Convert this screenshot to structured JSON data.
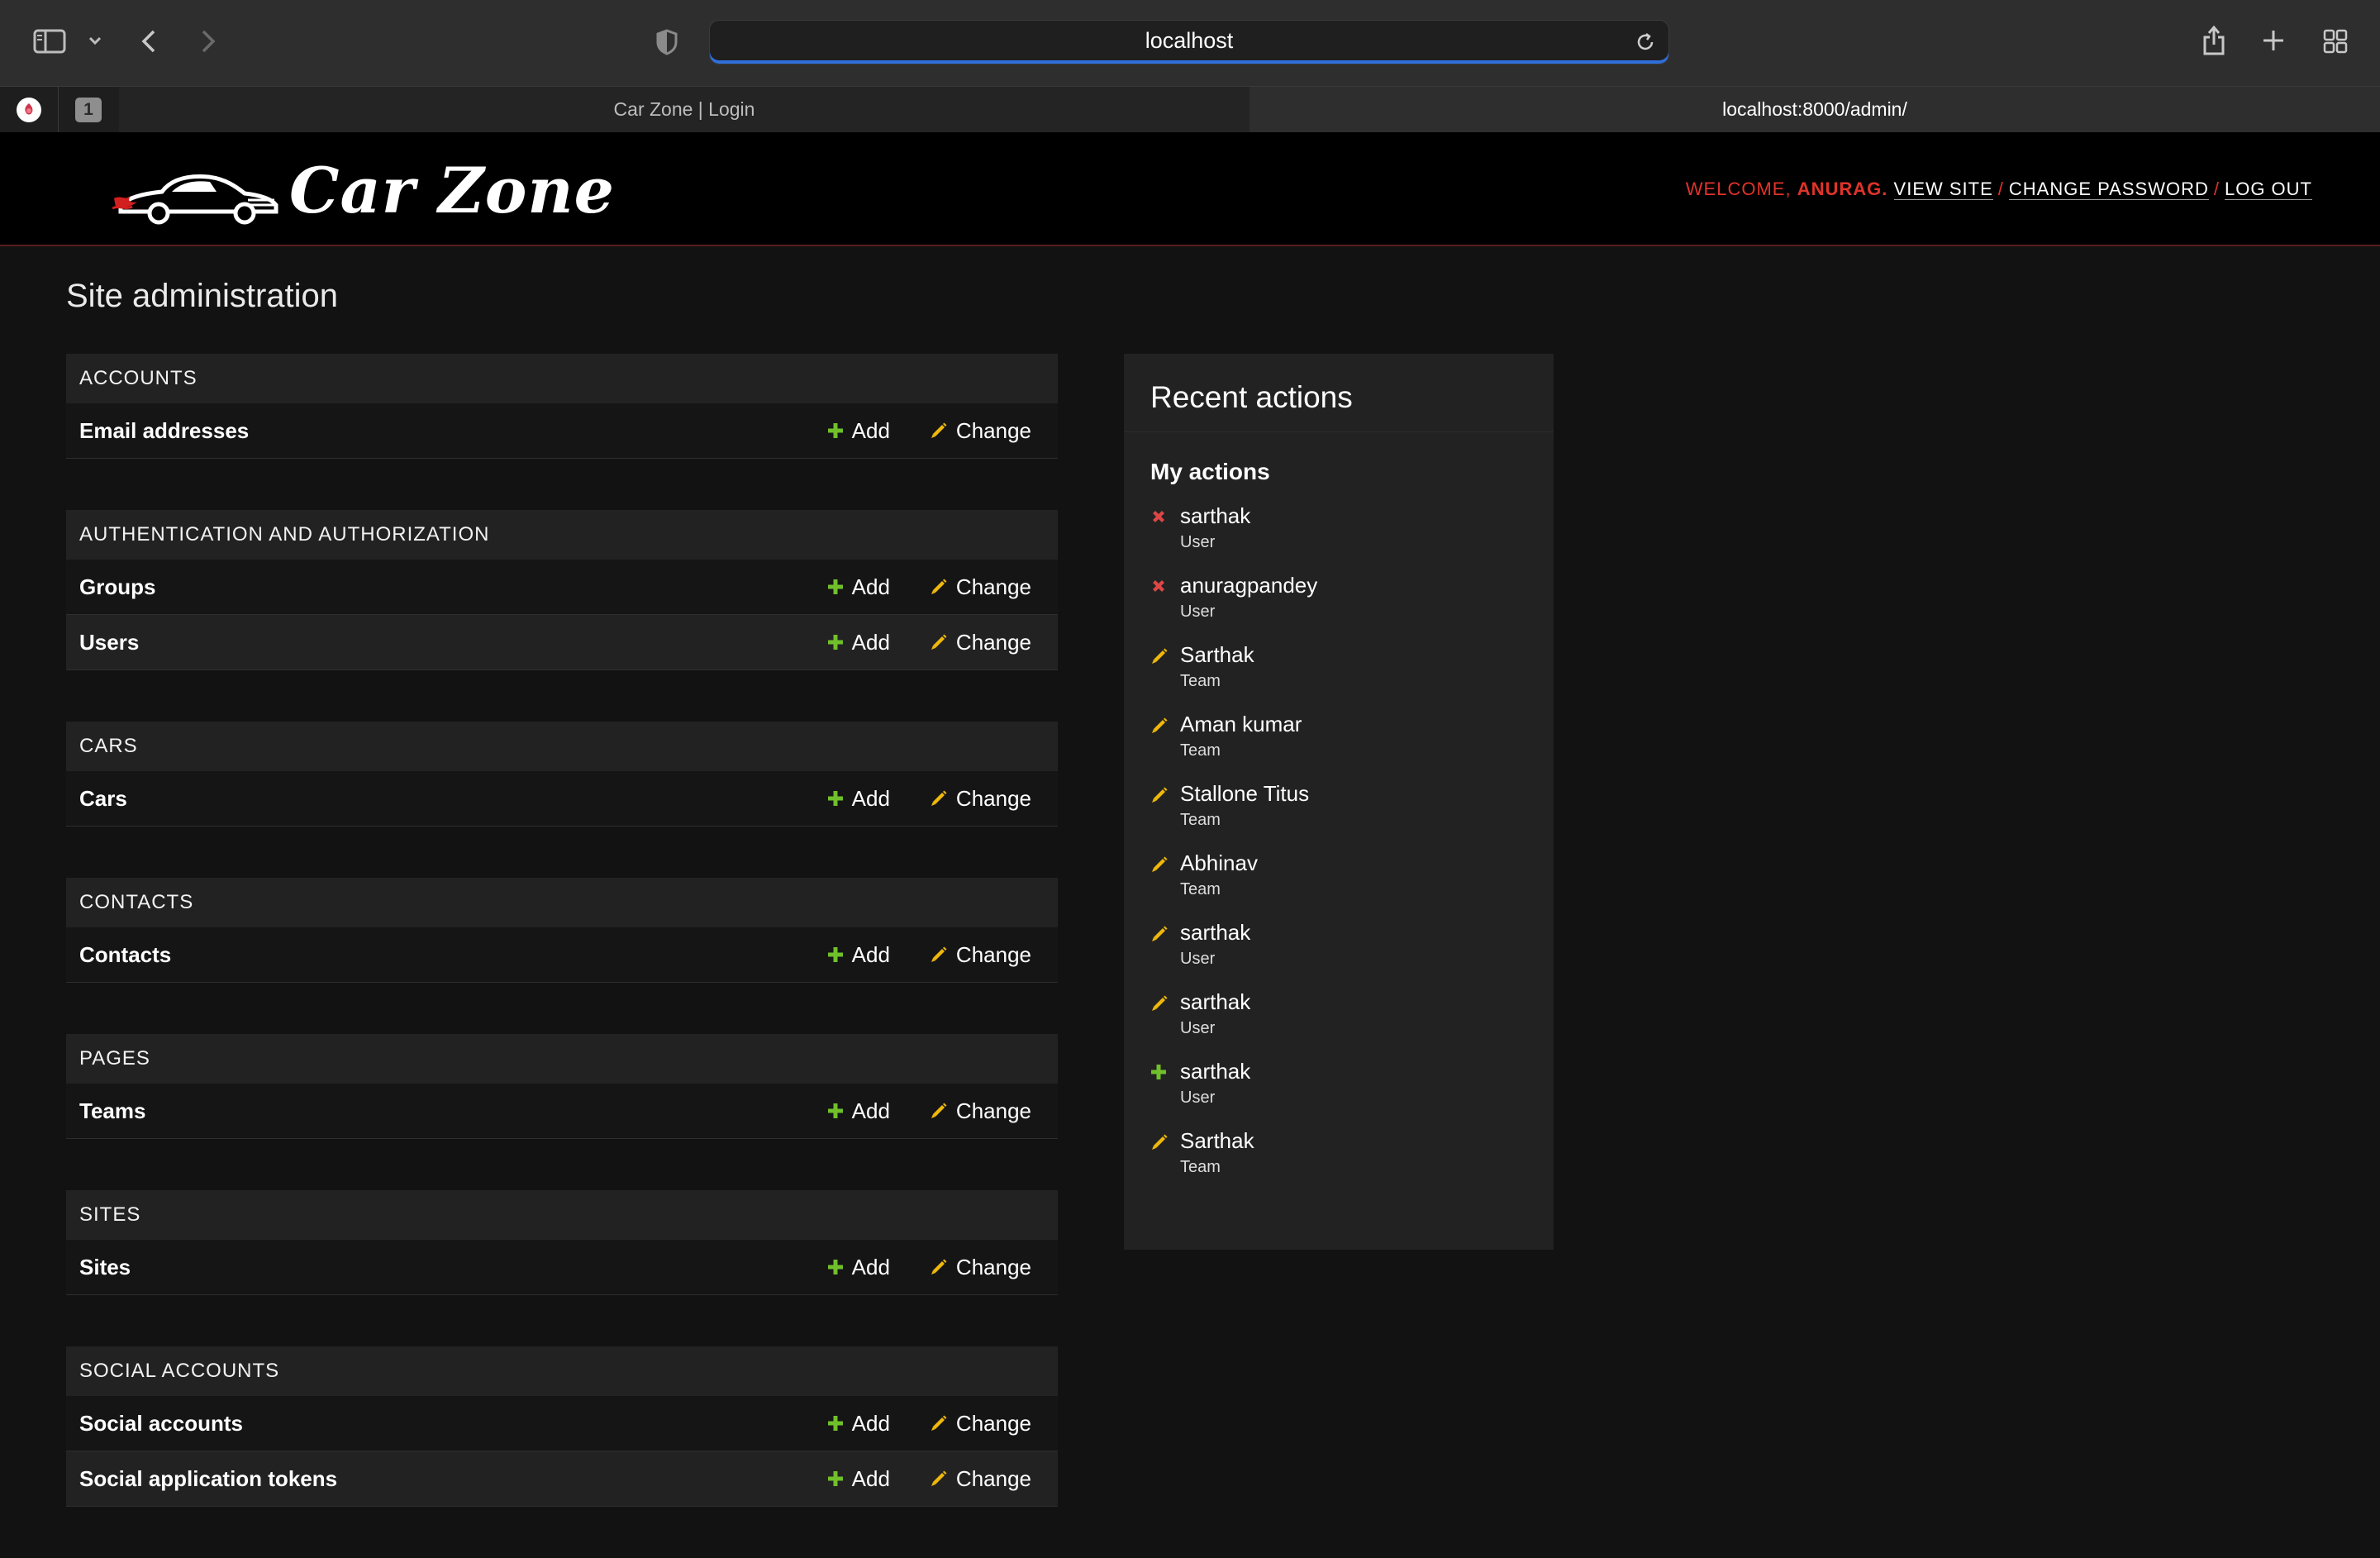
{
  "browser": {
    "url": "localhost",
    "tabs": [
      {
        "label": "Car Zone | Login",
        "active": false
      },
      {
        "label": "localhost:8000/admin/",
        "active": true
      }
    ],
    "tab_count_badge": "1"
  },
  "header": {
    "logo_text": "Car Zone",
    "welcome": "WELCOME,",
    "username": "ANURAG",
    "username_suffix": ".",
    "view_site": "VIEW SITE",
    "change_password": "CHANGE PASSWORD",
    "log_out": "LOG OUT",
    "separator": "/"
  },
  "page_title": "Site administration",
  "labels": {
    "add": "Add",
    "change": "Change"
  },
  "modules": [
    {
      "caption": "ACCOUNTS",
      "rows": [
        "Email addresses"
      ]
    },
    {
      "caption": "AUTHENTICATION AND AUTHORIZATION",
      "rows": [
        "Groups",
        "Users"
      ]
    },
    {
      "caption": "CARS",
      "rows": [
        "Cars"
      ]
    },
    {
      "caption": "CONTACTS",
      "rows": [
        "Contacts"
      ]
    },
    {
      "caption": "PAGES",
      "rows": [
        "Teams"
      ]
    },
    {
      "caption": "SITES",
      "rows": [
        "Sites"
      ]
    },
    {
      "caption": "SOCIAL ACCOUNTS",
      "rows": [
        "Social accounts",
        "Social application tokens"
      ]
    }
  ],
  "recent_actions": {
    "title": "Recent actions",
    "subtitle": "My actions",
    "items": [
      {
        "name": "sarthak",
        "type": "User",
        "action": "delete"
      },
      {
        "name": "anuragpandey",
        "type": "User",
        "action": "delete"
      },
      {
        "name": "Sarthak",
        "type": "Team",
        "action": "change"
      },
      {
        "name": "Aman kumar",
        "type": "Team",
        "action": "change"
      },
      {
        "name": "Stallone Titus",
        "type": "Team",
        "action": "change"
      },
      {
        "name": "Abhinav",
        "type": "Team",
        "action": "change"
      },
      {
        "name": "sarthak",
        "type": "User",
        "action": "change"
      },
      {
        "name": "sarthak",
        "type": "User",
        "action": "change"
      },
      {
        "name": "sarthak",
        "type": "User",
        "action": "add"
      },
      {
        "name": "Sarthak",
        "type": "Team",
        "action": "change"
      }
    ]
  },
  "colors": {
    "accent_red": "#e0332a",
    "add_green": "#70bf2b",
    "change_yellow": "#efb80b",
    "delete_red": "#dd4646",
    "url_focus": "#2f6fdc"
  }
}
